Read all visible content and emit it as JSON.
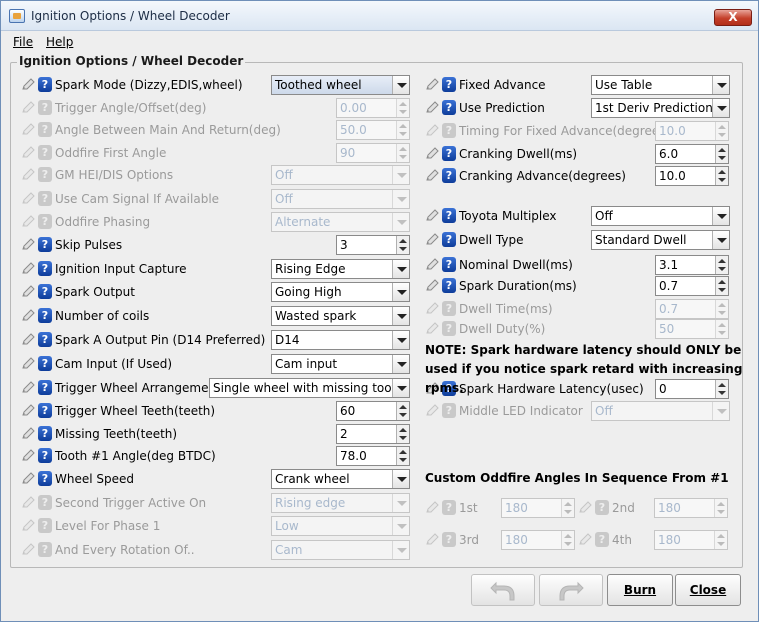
{
  "window": {
    "title": "Ignition Options / Wheel Decoder",
    "close_label": "X"
  },
  "menu": {
    "file": "File",
    "help": "Help"
  },
  "panel_title": "Ignition Options / Wheel Decoder",
  "left": [
    {
      "label": "Spark Mode (Dizzy,EDIS,wheel)",
      "type": "combo",
      "value": "Toothed wheel",
      "enabled": true
    },
    {
      "label": "Trigger Angle/Offset(deg)",
      "type": "spin",
      "value": "0.00",
      "enabled": false
    },
    {
      "label": "Angle Between Main And Return(deg)",
      "type": "spin",
      "value": "50.0",
      "enabled": false
    },
    {
      "label": "Oddfire First Angle",
      "type": "spin",
      "value": "90",
      "enabled": false
    },
    {
      "label": "GM HEI/DIS Options",
      "type": "combo",
      "value": "Off",
      "enabled": false
    },
    {
      "label": "Use Cam Signal If Available",
      "type": "combo",
      "value": "Off",
      "enabled": false
    },
    {
      "label": "Oddfire Phasing",
      "type": "combo",
      "value": "Alternate",
      "enabled": false
    },
    {
      "label": "Skip Pulses",
      "type": "spin",
      "value": "3",
      "enabled": true
    },
    {
      "label": "Ignition Input Capture",
      "type": "combo",
      "value": "Rising Edge",
      "enabled": true
    },
    {
      "label": "Spark Output",
      "type": "combo",
      "value": "Going High",
      "enabled": true
    },
    {
      "label": "Number of coils",
      "type": "combo",
      "value": "Wasted spark",
      "enabled": true
    },
    {
      "label": "Spark A Output Pin (D14 Preferred)",
      "type": "combo",
      "value": "D14",
      "enabled": true
    },
    {
      "label": "Cam Input (If Used)",
      "type": "combo",
      "value": "Cam input",
      "enabled": true
    },
    {
      "label": "Trigger Wheel Arrangement",
      "type": "combo",
      "value": "Single wheel with missing tooth",
      "enabled": true
    },
    {
      "label": "Trigger Wheel Teeth(teeth)",
      "type": "spin",
      "value": "60",
      "enabled": true
    },
    {
      "label": "Missing Teeth(teeth)",
      "type": "spin",
      "value": "2",
      "enabled": true
    },
    {
      "label": "Tooth #1 Angle(deg BTDC)",
      "type": "spin",
      "value": "78.0",
      "enabled": true
    },
    {
      "label": "Wheel Speed",
      "type": "combo",
      "value": "Crank wheel",
      "enabled": true
    },
    {
      "label": "Second Trigger Active On",
      "type": "combo",
      "value": "Rising edge",
      "enabled": false
    },
    {
      "label": "Level For Phase 1",
      "type": "combo",
      "value": "Low",
      "enabled": false
    },
    {
      "label": "And Every Rotation Of..",
      "type": "combo",
      "value": "Cam",
      "enabled": false
    }
  ],
  "right": [
    {
      "label": "Fixed Advance",
      "type": "combo",
      "value": "Use Table",
      "enabled": true
    },
    {
      "label": "Use Prediction",
      "type": "combo",
      "value": "1st Deriv Prediction",
      "enabled": true
    },
    {
      "label": "Timing For Fixed Advance(degrees)",
      "type": "spin",
      "value": "10.0",
      "enabled": false
    },
    {
      "label": "Cranking Dwell(ms)",
      "type": "spin",
      "value": "6.0",
      "enabled": true
    },
    {
      "label": "Cranking Advance(degrees)",
      "type": "spin",
      "value": "10.0",
      "enabled": true
    },
    {
      "label": "Toyota Multiplex",
      "type": "combo",
      "value": "Off",
      "enabled": true
    },
    {
      "label": "Dwell Type",
      "type": "combo",
      "value": "Standard Dwell",
      "enabled": true
    },
    {
      "label": "Nominal Dwell(ms)",
      "type": "spin",
      "value": "3.1",
      "enabled": true
    },
    {
      "label": "Spark Duration(ms)",
      "type": "spin",
      "value": "0.7",
      "enabled": true
    },
    {
      "label": "Dwell Time(ms)",
      "type": "spin",
      "value": "0.7",
      "enabled": false
    },
    {
      "label": "Dwell Duty(%)",
      "type": "spin",
      "value": "50",
      "enabled": false
    },
    {
      "label": "Spark Hardware Latency(usec)",
      "type": "spin",
      "value": "0",
      "enabled": true
    },
    {
      "label": "Middle LED Indicator",
      "type": "combo",
      "value": "Off",
      "enabled": false
    }
  ],
  "note": "NOTE: Spark hardware latency should ONLY be used if you notice spark retard with increasing rpms.",
  "oddfire_section": "Custom Oddfire Angles In Sequence From #1",
  "oddfire": [
    {
      "label": "1st",
      "value": "180"
    },
    {
      "label": "2nd",
      "value": "180"
    },
    {
      "label": "3rd",
      "value": "180"
    },
    {
      "label": "4th",
      "value": "180"
    }
  ],
  "buttons": {
    "burn": "Burn",
    "close": "Close"
  }
}
